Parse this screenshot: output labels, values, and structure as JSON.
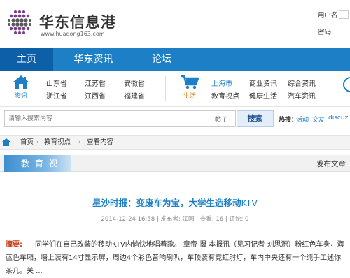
{
  "header": {
    "logo_text": "华东信息港",
    "logo_url": "www.huadong163.com",
    "username_label": "用户名",
    "password_label": "密码"
  },
  "nav": [
    {
      "label": "主页",
      "active": true
    },
    {
      "label": "华东资讯",
      "active": false
    },
    {
      "label": "论坛",
      "active": false
    }
  ],
  "categories": {
    "news": {
      "icon": "house-icon",
      "label": "资讯",
      "links": [
        "山东省",
        "江苏省",
        "安徽省",
        "浙江省",
        "江西省",
        "福建省"
      ]
    },
    "life": {
      "icon": "cart-icon",
      "label": "生活",
      "links": [
        "上海市",
        "商业资讯",
        "综合资讯",
        "教育视点",
        "健康生活",
        "汽车资讯"
      ]
    }
  },
  "search": {
    "placeholder": "请输入搜索内容",
    "scope": "帖子",
    "button": "搜索",
    "hot_label": "热搜：",
    "hot_links": [
      "活动",
      "交友",
      "discuz"
    ]
  },
  "breadcrumb": [
    "首页",
    "教育视点",
    "查看内容"
  ],
  "section": {
    "title": "教育视点",
    "right": "发布文章"
  },
  "article": {
    "title": "星沙时报：变废车为宝，大学生造移动",
    "title_suffix": "KTV",
    "date": "2014-12-24 16:58",
    "publisher_label": "发布者:",
    "publisher": "江圆",
    "views_label": "查看:",
    "views": "16",
    "comments_label": "评论:",
    "comments": "0",
    "abstract_label": "摘要:",
    "abstract": "同学们在自己改装的移动KTV内愉快地唱着歌。 章帝 摄    本报讯（见习记者 刘思源）粉红色车身，海蓝色车厢，墙上装有14寸显示屏，周边4个彩色音响喇叭，车顶装有霓虹射灯，车内中央还有一个纯手工迷你茶几。关 ..."
  }
}
